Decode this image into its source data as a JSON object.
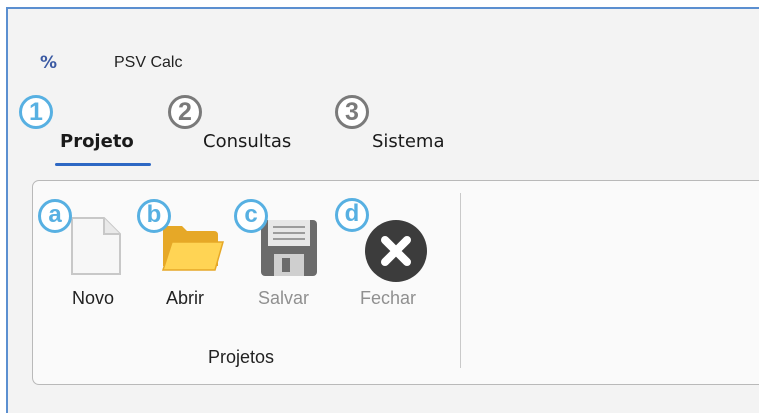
{
  "app": {
    "title": "PSV Calc",
    "icon": "percent-icon",
    "icon_glyph": "%"
  },
  "tabs": [
    {
      "label": "Projeto",
      "number": "1",
      "selected": true
    },
    {
      "label": "Consultas",
      "number": "2",
      "selected": false
    },
    {
      "label": "Sistema",
      "number": "3",
      "selected": false
    }
  ],
  "ribbon": {
    "group_label": "Projetos",
    "commands": [
      {
        "label": "Novo",
        "letter": "a",
        "icon": "new-document-icon",
        "enabled": true
      },
      {
        "label": "Abrir",
        "letter": "b",
        "icon": "folder-open-icon",
        "enabled": true
      },
      {
        "label": "Salvar",
        "letter": "c",
        "icon": "floppy-save-icon",
        "enabled": false
      },
      {
        "label": "Fechar",
        "letter": "d",
        "icon": "close-circle-icon",
        "enabled": false
      }
    ]
  },
  "colors": {
    "accent": "#2d68c4",
    "callout": "#57b0e2",
    "frame": "#5b8fd0"
  }
}
